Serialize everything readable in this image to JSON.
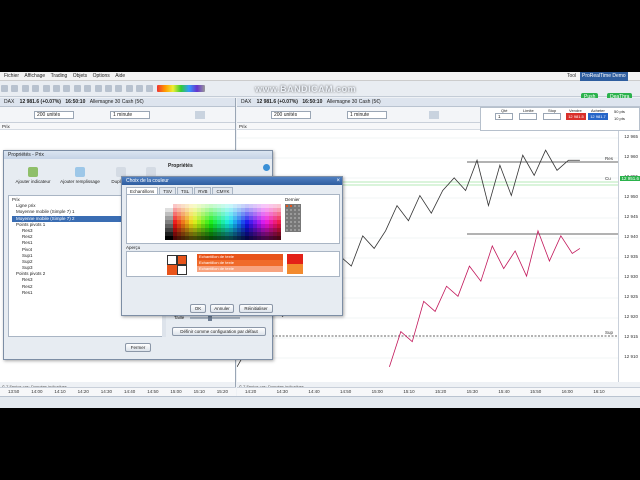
{
  "menu": [
    "Fichier",
    "Affichage",
    "Trading",
    "Objets",
    "Options",
    "Aide"
  ],
  "watermark": "www.BANDICAM.com",
  "top_right": {
    "tool_label": "Tool",
    "platform_label": "ProRealTime Demo",
    "btn1": "Push",
    "btn2": "DeaThra"
  },
  "colors": {
    "accent_green": "#2bb24c",
    "bid_red": "#d9302b",
    "ask_blue": "#2766c8",
    "price_line": "#333333",
    "price_line2": "#c2185b",
    "blue_title": "#3a6db3",
    "orange": "#e8541b",
    "dashed": "#222222"
  },
  "left_chart": {
    "header": {
      "symbol": "DAX",
      "price": "12 981.6 (+0.07%)",
      "time": "16:50:10",
      "name": "Allemagne 30 Cash (5€)"
    },
    "interval": "200 unités",
    "timeframe": "1 minute",
    "price_panel": "Prix",
    "xticks": [
      "13:50",
      "14:00",
      "14:10",
      "14:20",
      "14:30",
      "14:40",
      "14:50",
      "15:00",
      "15:10",
      "15:20"
    ],
    "footer": "© T Fenice cas: Données indicatives"
  },
  "right_chart": {
    "header": {
      "symbol": "DAX",
      "price": "12 981.6 (+0.07%)",
      "time": "16:50:10",
      "name": "Allemagne 30 Cash (5€)"
    },
    "interval": "200 unités",
    "timeframe": "1 minute",
    "price_panel": "Prix",
    "order_panel": {
      "qty_label": "Qté",
      "qty": "1",
      "limit_label": "Limite",
      "stop_label": "Stop",
      "sell_label": "Vendre",
      "buy_label": "Acheter",
      "sell_price": "12 981.5",
      "buy_price": "12 981.7",
      "spread": "10 pts",
      "opt1": "50 pts"
    },
    "yticks": [
      "12 965",
      "12 960",
      "12 955",
      "12 950",
      "12 945",
      "12 940",
      "12 935",
      "12 930",
      "12 925",
      "12 920",
      "12 915",
      "12 910"
    ],
    "price_tag": "12 951.6",
    "lbl_cu": "Cu",
    "lbl_sup": "Sup",
    "lbl_res": "Res",
    "xticks": [
      "14:20",
      "14:30",
      "14:40",
      "14:50",
      "15:00",
      "15:10",
      "15:20",
      "15:30",
      "15:40",
      "15:50",
      "16:00",
      "16:10"
    ],
    "footer": "© T Fenice cas: Données indicatives",
    "black_series": [
      [
        0.0,
        0.94
      ],
      [
        0.03,
        0.86
      ],
      [
        0.06,
        0.82
      ],
      [
        0.09,
        0.7
      ],
      [
        0.12,
        0.74
      ],
      [
        0.15,
        0.6
      ],
      [
        0.18,
        0.66
      ],
      [
        0.21,
        0.54
      ],
      [
        0.24,
        0.62
      ],
      [
        0.27,
        0.5
      ],
      [
        0.3,
        0.54
      ],
      [
        0.33,
        0.42
      ],
      [
        0.36,
        0.47
      ],
      [
        0.39,
        0.4
      ],
      [
        0.42,
        0.3
      ],
      [
        0.45,
        0.36
      ],
      [
        0.48,
        0.26
      ],
      [
        0.51,
        0.33
      ],
      [
        0.54,
        0.24
      ],
      [
        0.57,
        0.19
      ],
      [
        0.6,
        0.24
      ],
      [
        0.63,
        0.12
      ],
      [
        0.66,
        0.3
      ],
      [
        0.69,
        0.14
      ],
      [
        0.72,
        0.26
      ],
      [
        0.75,
        0.1
      ],
      [
        0.78,
        0.18
      ],
      [
        0.81,
        0.08
      ],
      [
        0.84,
        0.16
      ],
      [
        0.87,
        0.12
      ],
      [
        0.9,
        0.12
      ]
    ],
    "red_series": [
      [
        0.4,
        0.94
      ],
      [
        0.43,
        0.8
      ],
      [
        0.46,
        0.84
      ],
      [
        0.49,
        0.68
      ],
      [
        0.52,
        0.72
      ],
      [
        0.55,
        0.62
      ],
      [
        0.58,
        0.66
      ],
      [
        0.61,
        0.54
      ],
      [
        0.64,
        0.6
      ],
      [
        0.67,
        0.46
      ],
      [
        0.7,
        0.55
      ],
      [
        0.73,
        0.48
      ],
      [
        0.76,
        0.58
      ],
      [
        0.79,
        0.4
      ],
      [
        0.82,
        0.52
      ],
      [
        0.85,
        0.42
      ],
      [
        0.88,
        0.49
      ],
      [
        0.9,
        0.47
      ]
    ]
  },
  "properties_dialog": {
    "title": "Propriétés - Prix",
    "add_indicator": "Ajouter indicateur",
    "add_fill": "Ajouter remplissage",
    "duplicate": "Dupliquer",
    "delete": "Supprimer",
    "right_title": "Propriétés",
    "tree": [
      "Prix",
      "Ligne prix",
      "Moyenne mobile (Simple 7) 1",
      "Moyenne mobile (Simple 7) 2",
      "Points pivots 1",
      "Res3",
      "Res2",
      "Res1",
      "Pivot",
      "Sup1",
      "Sup2",
      "Sup3",
      "Points pivots 2",
      "Res3",
      "Res2",
      "Res1"
    ],
    "size_label": "Taille",
    "default_btn": "Définir comme configuration par défaut",
    "close_btn": "Fermer"
  },
  "color_dialog": {
    "title": "Choix de la couleur",
    "tabs": [
      "Echantillons",
      "TSV",
      "TSL",
      "RVB",
      "CMYK"
    ],
    "recent_label": "Dernier",
    "preview_label": "Aperçu",
    "sample_text": "Echantillon de texte",
    "ok": "OK",
    "cancel": "Annuler",
    "reset": "Réinitialiser"
  }
}
